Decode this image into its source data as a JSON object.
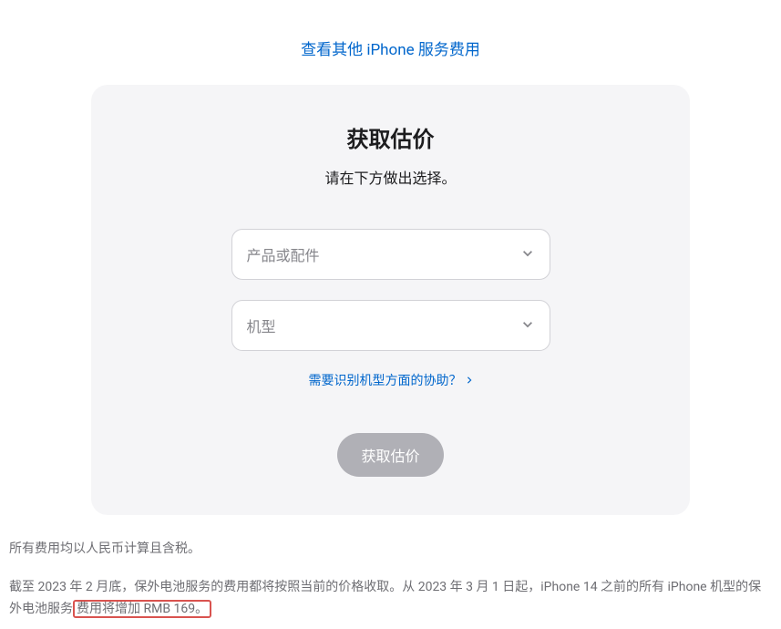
{
  "header": {
    "topLink": "查看其他 iPhone 服务费用"
  },
  "card": {
    "title": "获取估价",
    "subtitle": "请在下方做出选择。",
    "productSelect": "产品或配件",
    "modelSelect": "机型",
    "helpLink": "需要识别机型方面的协助？",
    "button": "获取估价"
  },
  "footer": {
    "line1": "所有费用均以人民币计算且含税。",
    "line2_prefix": "截至 2023 年 2 月底，保外电池服务的费用都将按照当前的价格收取。从 2023 年 3 月 1 日起，iPhone 14 之前的所有 iPhone 机型的保外电池服务",
    "line2_highlight": "费用将增加 RMB 169。"
  }
}
